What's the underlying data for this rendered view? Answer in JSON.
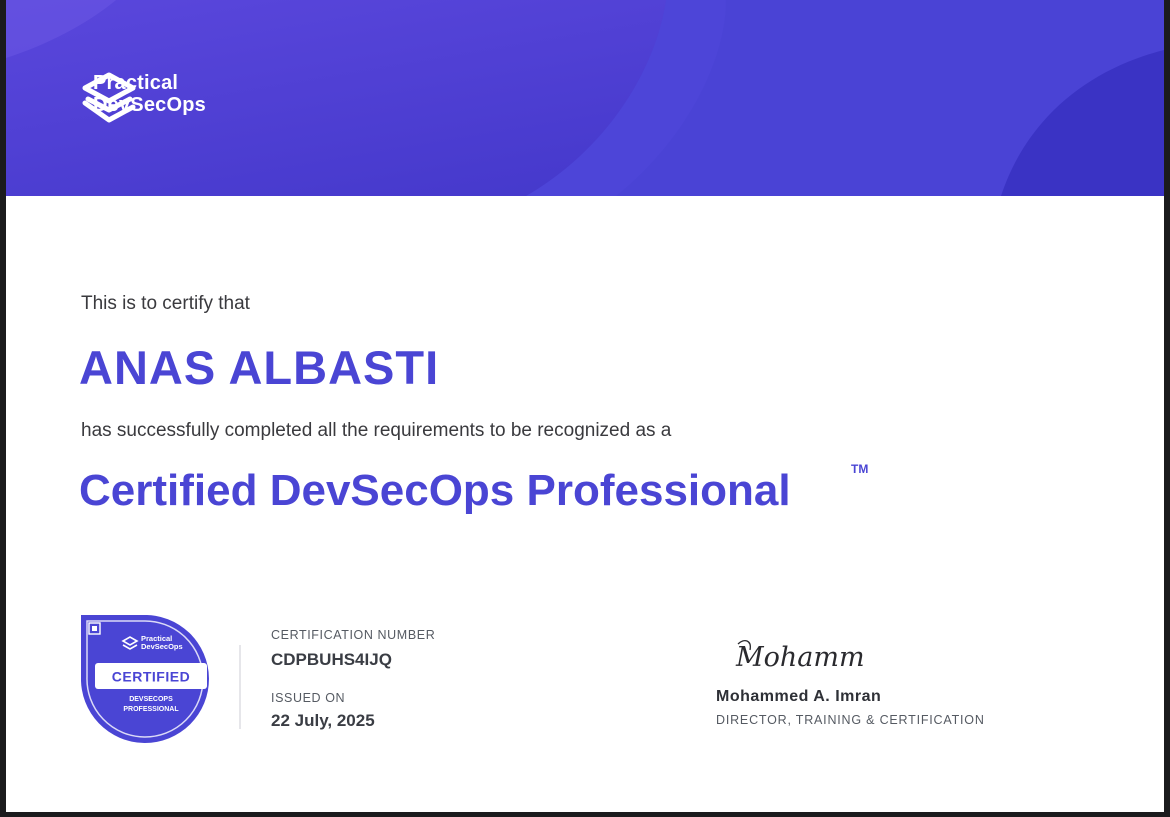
{
  "logo": {
    "line1": "Practical",
    "line2": "DevSecOps"
  },
  "certificate": {
    "intro": "This is to certify that",
    "recipient_name": "ANAS ALBASTI",
    "statement": "has successfully completed all the requirements to be recognized as a",
    "title": "Certified DevSecOps Professional",
    "trademark": "TM"
  },
  "badge": {
    "brand_line1": "Practical",
    "brand_line2": "DevSecOps",
    "ribbon": "CERTIFIED",
    "subtitle_line1": "DEVSECOPS",
    "subtitle_line2": "PROFESSIONAL"
  },
  "details": {
    "number_label": "CERTIFICATION NUMBER",
    "number_value": "CDPBUHS4IJQ",
    "issued_label": "ISSUED ON",
    "issued_value": "22 July, 2025"
  },
  "signatory": {
    "signature_text": "Mohammed",
    "name": "Mohammed A. Imran",
    "role": "DIRECTOR, TRAINING & CERTIFICATION"
  },
  "colors": {
    "brand_primary": "#4a45d4",
    "banner": "#4c3fd6"
  }
}
